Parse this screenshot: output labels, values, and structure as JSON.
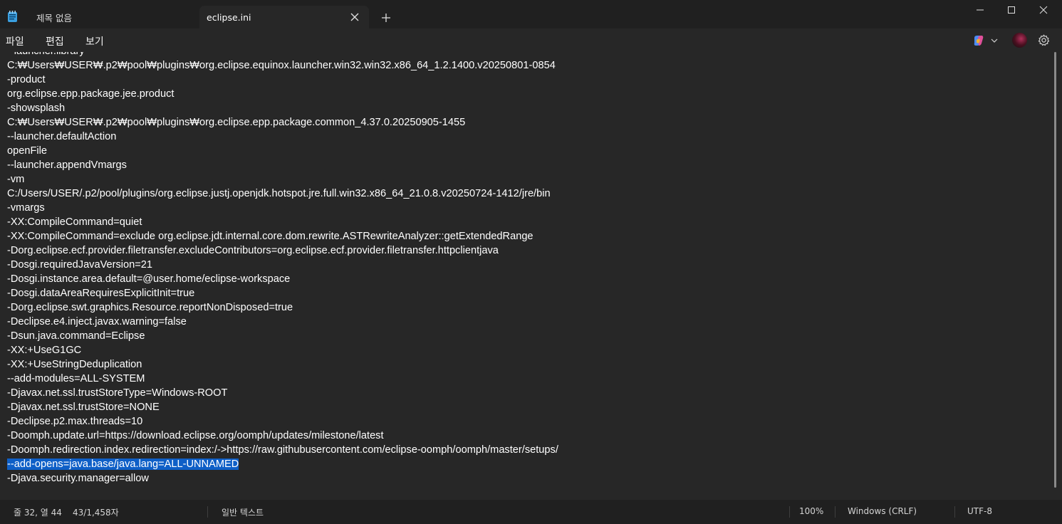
{
  "tabs": [
    {
      "title": "제목 없음",
      "active": false
    },
    {
      "title": "eclipse.ini",
      "active": true
    }
  ],
  "menu": [
    "파일",
    "편집",
    "보기"
  ],
  "editor": {
    "lines": [
      "--launcher.library",
      "C:₩Users₩USER₩.p2₩pool₩plugins₩org.eclipse.equinox.launcher.win32.win32.x86_64_1.2.1400.v20250801-0854",
      "-product",
      "org.eclipse.epp.package.jee.product",
      "-showsplash",
      "C:₩Users₩USER₩.p2₩pool₩plugins₩org.eclipse.epp.package.common_4.37.0.20250905-1455",
      "--launcher.defaultAction",
      "openFile",
      "--launcher.appendVmargs",
      "-vm",
      "C:/Users/USER/.p2/pool/plugins/org.eclipse.justj.openjdk.hotspot.jre.full.win32.x86_64_21.0.8.v20250724-1412/jre/bin",
      "-vmargs",
      "-XX:CompileCommand=quiet",
      "-XX:CompileCommand=exclude org.eclipse.jdt.internal.core.dom.rewrite.ASTRewriteAnalyzer::getExtendedRange",
      "-Dorg.eclipse.ecf.provider.filetransfer.excludeContributors=org.eclipse.ecf.provider.filetransfer.httpclientjava",
      "-Dosgi.requiredJavaVersion=21",
      "-Dosgi.instance.area.default=@user.home/eclipse-workspace",
      "-Dosgi.dataAreaRequiresExplicitInit=true",
      "-Dorg.eclipse.swt.graphics.Resource.reportNonDisposed=true",
      "-Declipse.e4.inject.javax.warning=false",
      "-Dsun.java.command=Eclipse",
      "-XX:+UseG1GC",
      "-XX:+UseStringDeduplication",
      "--add-modules=ALL-SYSTEM",
      "-Djavax.net.ssl.trustStoreType=Windows-ROOT",
      "-Djavax.net.ssl.trustStore=NONE",
      "-Declipse.p2.max.threads=10",
      "-Doomph.update.url=https://download.eclipse.org/oomph/updates/milestone/latest",
      "-Doomph.redirection.index.redirection=index:/->https://raw.githubusercontent.com/eclipse-oomph/oomph/master/setups/",
      "--add-opens=java.base/java.lang=ALL-UNNAMED",
      "-Djava.security.manager=allow"
    ],
    "selected_line_index": 29
  },
  "status": {
    "position": "줄 32, 열 44",
    "chars": "43/1,458자",
    "type": "일반 텍스트",
    "zoom": "100%",
    "eol": "Windows (CRLF)",
    "encoding": "UTF-8"
  },
  "colors": {
    "selection": "#0e5fc7",
    "background": "#272727",
    "titlebar": "#202020"
  },
  "icons": [
    "notepad-icon",
    "close-icon",
    "plus-icon",
    "minimize-icon",
    "maximize-icon",
    "close-window-icon",
    "copilot-icon",
    "chevron-down-icon",
    "avatar",
    "gear-icon"
  ]
}
